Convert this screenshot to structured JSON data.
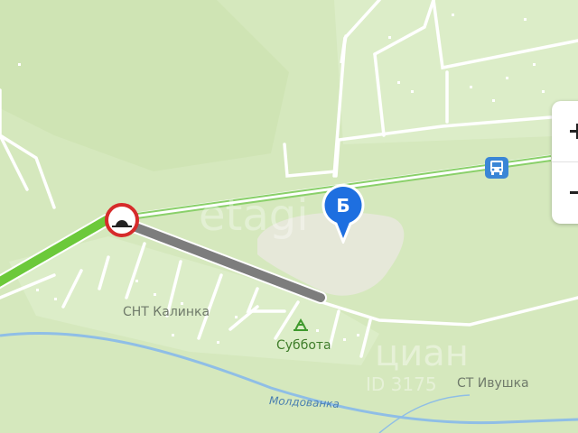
{
  "map": {
    "area_labels": [
      "СНТ Калинка",
      "СТ Ивушка"
    ],
    "poi_label": "Суббота",
    "river_label": "Молдованка",
    "marker_letter": "Б",
    "colors": {
      "background": "#d5e8bd",
      "road": "#ffffff",
      "traffic_free": "#6cc93a",
      "closed_road": "#7d7d7d",
      "marker": "#1e6fe0",
      "water": "#6fa5d8"
    },
    "icons": [
      "speed-bump-sign-icon",
      "bus-stop-icon",
      "recreation-icon"
    ],
    "watermarks": [
      "etagi",
      "циан",
      "ID 3175"
    ]
  },
  "zoom": {
    "in_icon": "plus-icon",
    "out_icon": "minus-icon"
  }
}
